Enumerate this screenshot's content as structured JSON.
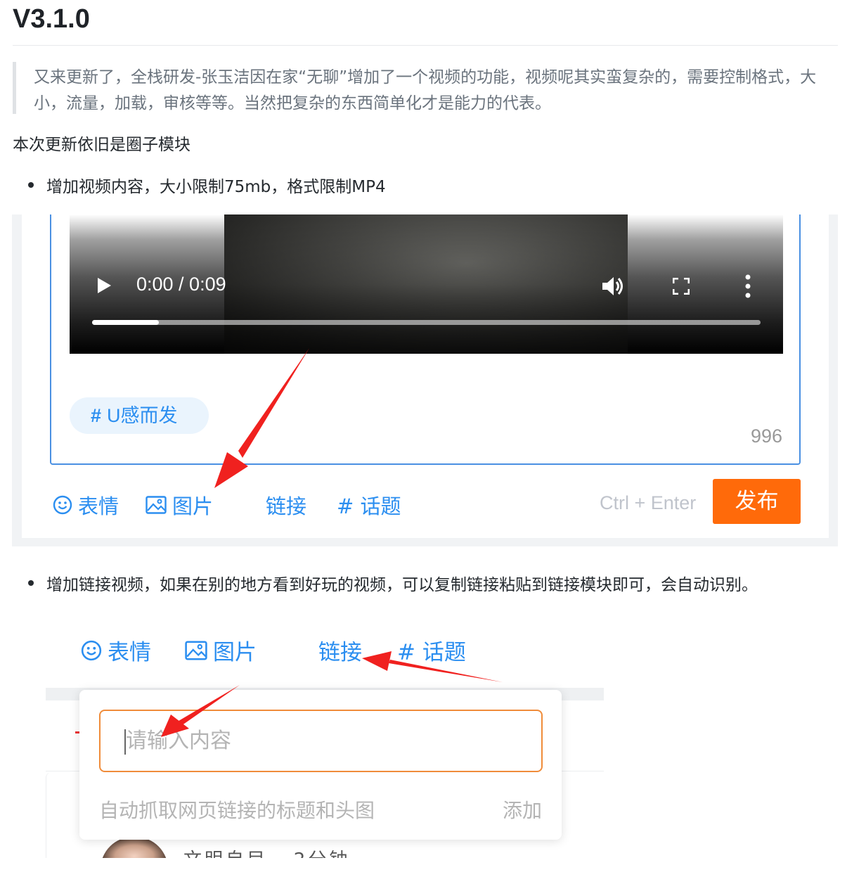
{
  "version": "V3.1.0",
  "intro": "又来更新了，全栈研发-张玉洁因在家“无聊”增加了一个视频的功能，视频呢其实蛮复杂的，需要控制格式，大小，流量，加载，审核等等。当然把复杂的东西简单化才是能力的代表。",
  "lead": "本次更新依旧是圈子模块",
  "bullets": [
    "增加视频内容，大小限制75mb，格式限制MP4",
    "增加链接视频，如果在别的地方看到好玩的视频，可以复制链接粘贴到链接模块即可，会自动识别。"
  ],
  "screenshot1": {
    "video": {
      "time": "0:00 / 0:09",
      "progress": 0.1
    },
    "topic_chip": {
      "hash": "#",
      "label": "U感而发"
    },
    "char_count": "996",
    "toolbar": {
      "emoji": "表情",
      "image": "图片",
      "link": "链接",
      "topic": "# 话题"
    },
    "shortcut_hint": "Ctrl + Enter",
    "publish": "发布"
  },
  "screenshot2": {
    "toolbar": {
      "emoji": "表情",
      "image": "图片",
      "link": "链接",
      "topic": "# 话题"
    },
    "input_placeholder": "请输入内容",
    "hint": "自动抓取网页链接的标题和头图",
    "add": "添加"
  },
  "colors": {
    "accent": "#2b8ef0",
    "publish": "#ff6a0a",
    "arrow": "#f0211f",
    "input_border": "#f08c3a"
  },
  "icons": [
    "play-icon",
    "volume-icon",
    "fullscreen-icon",
    "more-vertical-icon",
    "smile-icon",
    "image-icon"
  ]
}
